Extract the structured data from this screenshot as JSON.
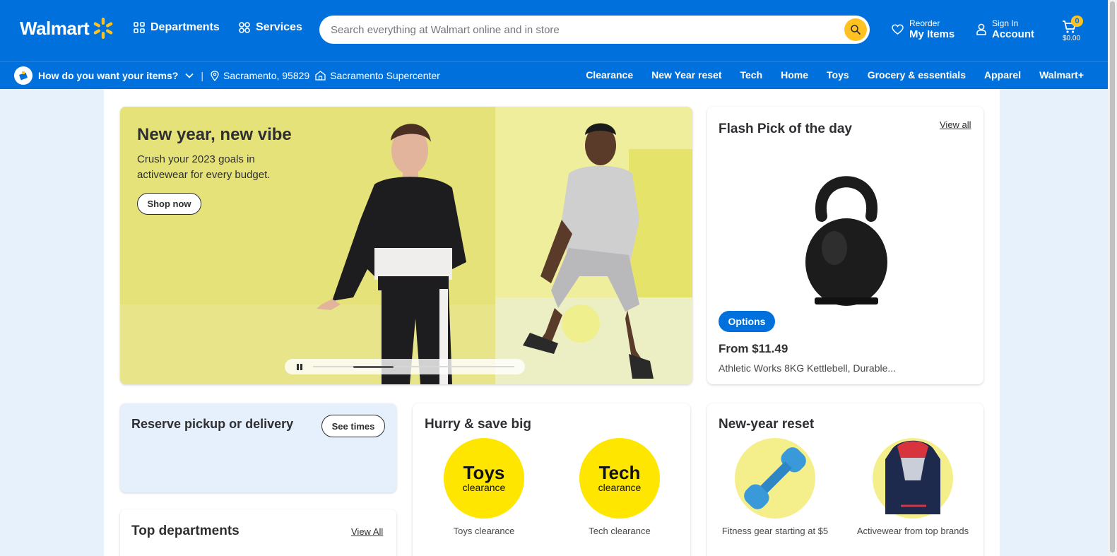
{
  "header": {
    "logo_text": "Walmart",
    "departments_label": "Departments",
    "services_label": "Services",
    "search_placeholder": "Search everything at Walmart online and in store",
    "reorder_small": "Reorder",
    "reorder_big": "My Items",
    "signin_small": "Sign In",
    "signin_big": "Account",
    "cart_count": "0",
    "cart_total": "$0.00"
  },
  "subbar": {
    "delivery_prompt": "How do you want your items?",
    "location": "Sacramento, 95829",
    "store": "Sacramento Supercenter",
    "links": [
      "Clearance",
      "New Year reset",
      "Tech",
      "Home",
      "Toys",
      "Grocery & essentials",
      "Apparel",
      "Walmart+"
    ]
  },
  "hero": {
    "title": "New year, new vibe",
    "subtitle": "Crush your 2023 goals in activewear for every budget.",
    "cta": "Shop now",
    "carousel_progress": 0.2
  },
  "flash": {
    "title": "Flash Pick of the day",
    "view_all": "View all",
    "options_label": "Options",
    "price": "From $11.49",
    "product_name": "Athletic Works 8KG Kettlebell, Durable..."
  },
  "reserve": {
    "title": "Reserve pickup or delivery",
    "button": "See times"
  },
  "top_departments": {
    "title": "Top departments",
    "view_all": "View All"
  },
  "hurry": {
    "title": "Hurry & save big",
    "items": [
      {
        "big": "Toys",
        "small": "clearance",
        "label": "Toys clearance"
      },
      {
        "big": "Tech",
        "small": "clearance",
        "label": "Tech clearance"
      }
    ]
  },
  "reset": {
    "title": "New-year reset",
    "items": [
      {
        "label": "Fitness gear starting at $5"
      },
      {
        "label": "Activewear from top brands"
      }
    ]
  },
  "colors": {
    "brand_blue": "#0071dc",
    "spark_yellow": "#ffc220",
    "clearance_yellow": "#ffe600"
  }
}
